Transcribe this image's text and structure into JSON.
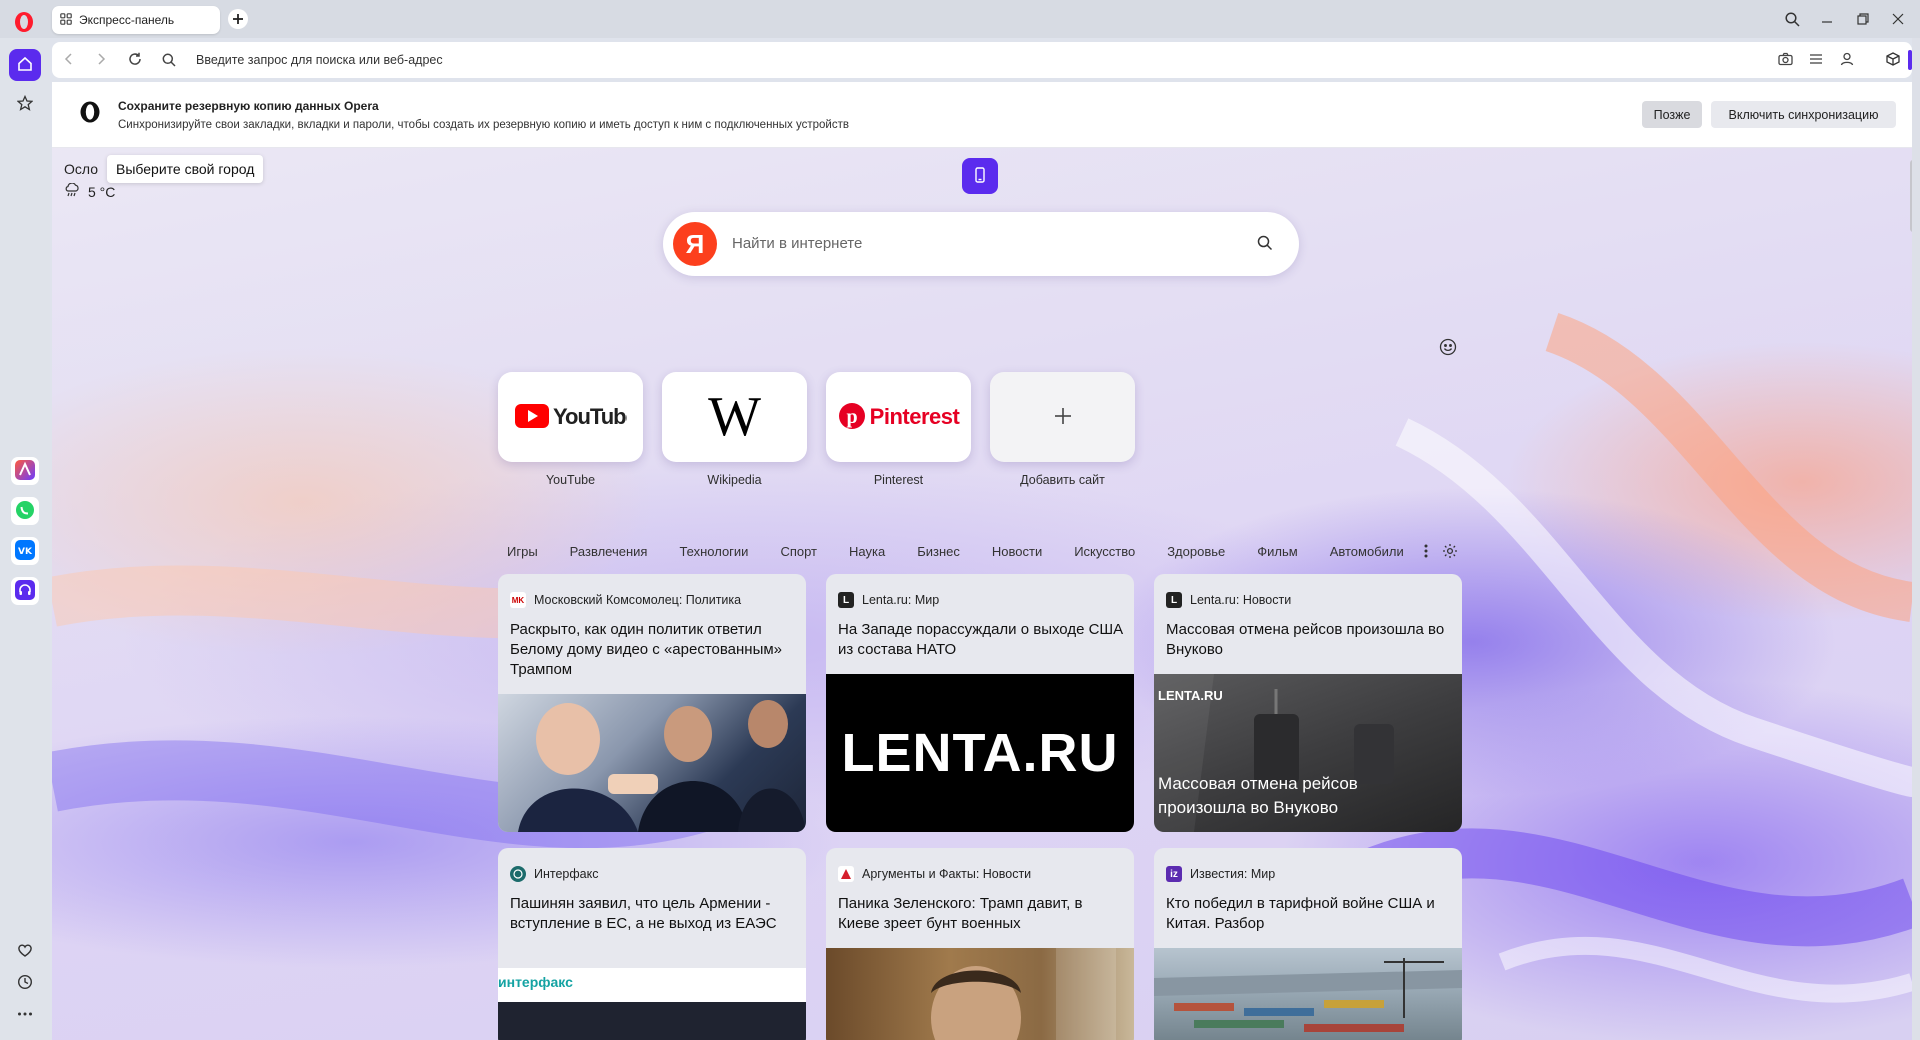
{
  "window": {
    "tab_title": "Экспресс-панель",
    "colors": {
      "accent": "#5b2bee",
      "opera_red": "#ff1b2d",
      "yandex": "#fc3f1d"
    }
  },
  "toolbar": {
    "url_placeholder": "Введите запрос для поиска или веб-адрес"
  },
  "sync_banner": {
    "title": "Сохраните резервную копию данных Opera",
    "description": "Синхронизируйте свои закладки, вкладки и пароли, чтобы создать их резервную копию и иметь доступ к ним с подключенных устройств",
    "later_label": "Позже",
    "enable_label": "Включить синхронизацию"
  },
  "weather": {
    "city": "Осло",
    "tooltip": "Выберите свой город",
    "temperature": "5 °C"
  },
  "search": {
    "logo_letter": "Я",
    "placeholder": "Найти в интернете"
  },
  "speed_dial": [
    {
      "label": "YouTube"
    },
    {
      "label": "Wikipedia",
      "logo": "W"
    },
    {
      "label": "Pinterest",
      "logo": "Pinterest"
    },
    {
      "label": "Добавить сайт"
    }
  ],
  "categories": [
    "Игры",
    "Развлечения",
    "Технологии",
    "Спорт",
    "Наука",
    "Бизнес",
    "Новости",
    "Искусство",
    "Здоровье",
    "Фильм",
    "Автомобили"
  ],
  "news": [
    {
      "source": "Московский Комсомолец: Политика",
      "icon_text": "MK",
      "title": "Раскрыто, как один политик ответил Белому дому видео с «арестованным» Трампом"
    },
    {
      "source": "Lenta.ru: Мир",
      "icon_text": "L",
      "title": "На Западе порассуждали о выходе США из состава НАТО",
      "image_text": "LENTA.RU"
    },
    {
      "source": "Lenta.ru: Новости",
      "icon_text": "L",
      "title": "Массовая отмена рейсов произошла во Внуково",
      "image_brand": "LENTA.RU",
      "image_caption": "Массовая отмена рейсов произошла во Внуково"
    },
    {
      "source": "Интерфакс",
      "icon_text": "",
      "title": "Пашинян заявил, что цель Армении - вступление в ЕС, а не выход из ЕАЭС",
      "image_brand": "интерфакс"
    },
    {
      "source": "Аргументы и Факты: Новости",
      "icon_text": "",
      "title": "Паника Зеленского: Трамп давит, в Киеве зреет бунт военных"
    },
    {
      "source": "Известия: Мир",
      "icon_text": "iz",
      "title": "Кто победил в тарифной войне США и Китая. Разбор"
    }
  ]
}
